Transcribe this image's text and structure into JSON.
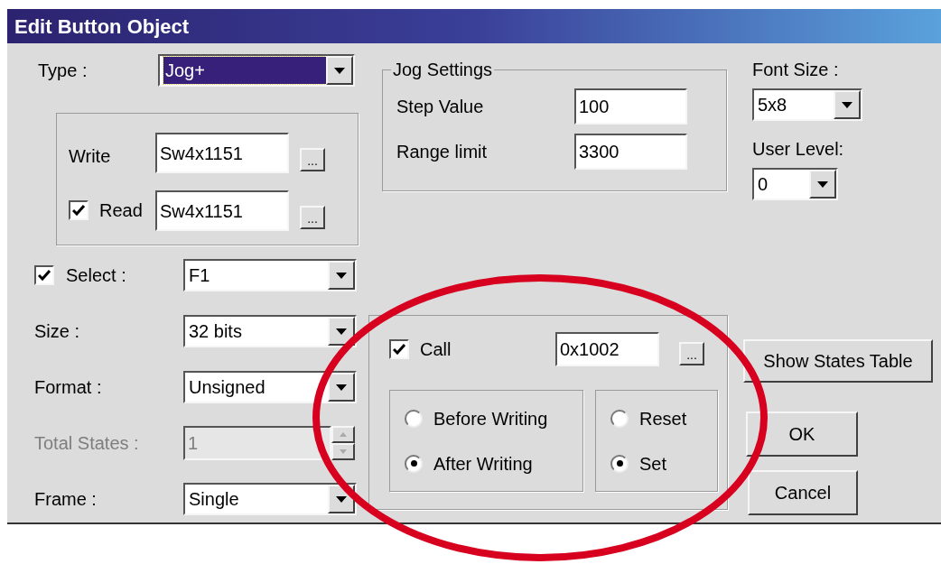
{
  "window": {
    "title": "Edit Button Object"
  },
  "type_field": {
    "label": "Type :",
    "value": "Jog+",
    "focused": true
  },
  "address_group": {
    "write": {
      "label": "Write",
      "value": "Sw4x1151",
      "browse": "..."
    },
    "read": {
      "label": "Read",
      "checked": true,
      "value": "Sw4x1151",
      "browse": "..."
    }
  },
  "fields": [
    {
      "kind": "check_dropdown",
      "label": "Select :",
      "checked": true,
      "value": "F1"
    },
    {
      "kind": "dropdown",
      "label": "Size :",
      "value": "32 bits"
    },
    {
      "kind": "dropdown",
      "label": "Format :",
      "value": "Unsigned"
    },
    {
      "kind": "spinner",
      "label": "Total States :",
      "value": "1",
      "disabled": true
    },
    {
      "kind": "dropdown",
      "label": "Frame :",
      "value": "Single"
    }
  ],
  "jog_settings": {
    "title": "Jog Settings",
    "fields": [
      {
        "label": "Step Value",
        "value": "100"
      },
      {
        "label": "Range limit",
        "value": "3300"
      }
    ]
  },
  "font_size": {
    "label": "Font Size :",
    "value": "5x8"
  },
  "user_level": {
    "label": "User Level:",
    "value": "0"
  },
  "call_group": {
    "label": "Call",
    "checked": true,
    "value": "0x1002",
    "browse": "...",
    "timing": [
      {
        "label": "Before Writing",
        "selected": false
      },
      {
        "label": "After Writing",
        "selected": true
      }
    ],
    "action": [
      {
        "label": "Reset",
        "selected": false
      },
      {
        "label": "Set",
        "selected": true
      }
    ]
  },
  "buttons": {
    "show_states": "Show States Table",
    "ok": "OK",
    "cancel": "Cancel"
  },
  "annotation": {
    "kind": "ellipse"
  }
}
